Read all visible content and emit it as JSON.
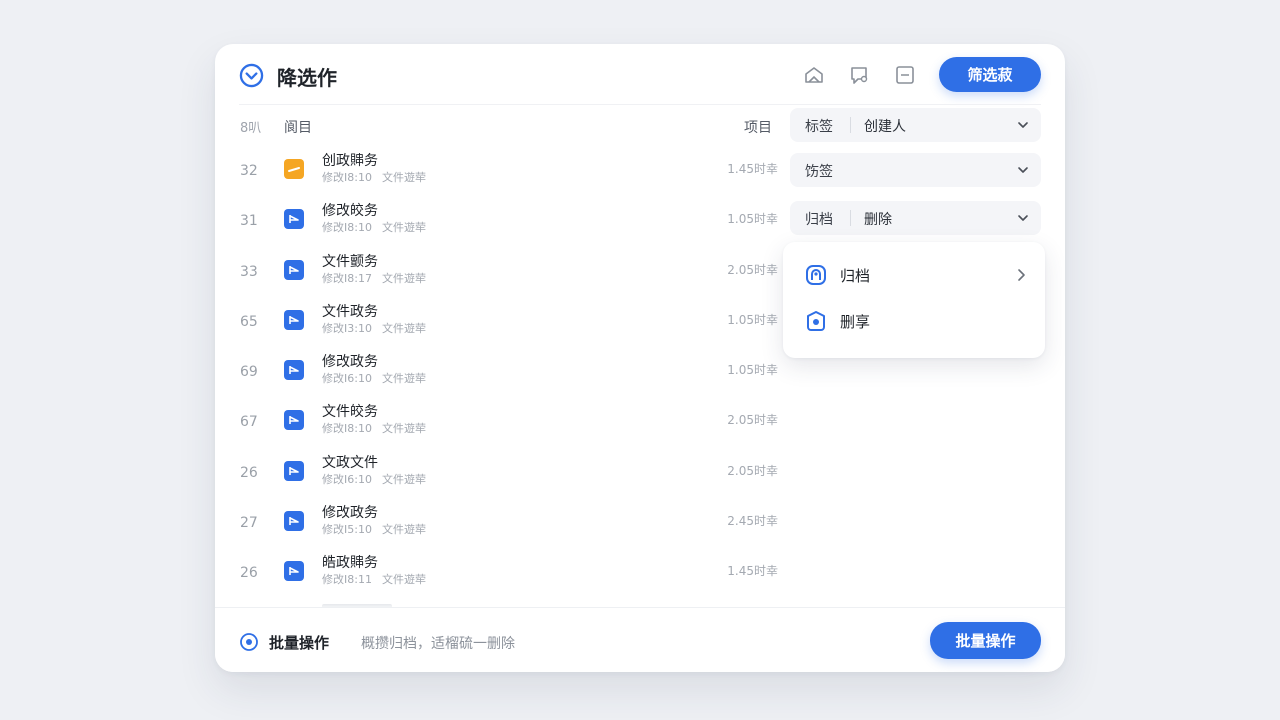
{
  "header": {
    "title": "降选作",
    "icons": [
      "home-icon",
      "chat-icon",
      "minus-square-icon"
    ],
    "primary_button": "筛选菽"
  },
  "columns": {
    "id": "8叭",
    "name": "阆目",
    "size": "项目"
  },
  "rows": [
    {
      "id": "32",
      "name": "创政賗务",
      "meta_time": "修改I8:10",
      "meta_type": "文件遊荦",
      "size": "1.45时幸",
      "icon_color": "#f5a623"
    },
    {
      "id": "31",
      "name": "修改皎务",
      "meta_time": "修改I8:10",
      "meta_type": "文件遊荦",
      "size": "1.05时幸",
      "icon_color": "#2f6fe6"
    },
    {
      "id": "33",
      "name": "文件颤务",
      "meta_time": "修改I8:17",
      "meta_type": "文件遊荦",
      "size": "2.05时幸",
      "icon_color": "#2f6fe6"
    },
    {
      "id": "65",
      "name": "文件政务",
      "meta_time": "修改I3:10",
      "meta_type": "文件遊荦",
      "size": "1.05时幸",
      "icon_color": "#2f6fe6"
    },
    {
      "id": "69",
      "name": "修改政务",
      "meta_time": "修改I6:10",
      "meta_type": "文件遊荦",
      "size": "1.05时幸",
      "icon_color": "#2f6fe6"
    },
    {
      "id": "67",
      "name": "文件皎务",
      "meta_time": "修改I8:10",
      "meta_type": "文件遊荦",
      "size": "2.05时幸",
      "icon_color": "#2f6fe6"
    },
    {
      "id": "26",
      "name": "文政文件",
      "meta_time": "修改I6:10",
      "meta_type": "文件遊荦",
      "size": "2.05时幸",
      "icon_color": "#2f6fe6"
    },
    {
      "id": "27",
      "name": "修改政务",
      "meta_time": "修改I5:10",
      "meta_type": "文件遊荦",
      "size": "2.45时幸",
      "icon_color": "#2f6fe6"
    },
    {
      "id": "26",
      "name": "皓政賗务",
      "meta_time": "修改I8:11",
      "meta_type": "文件遊荦",
      "size": "1.45时幸",
      "icon_color": "#2f6fe6"
    }
  ],
  "filters": [
    {
      "label": "标签",
      "value": "创建人"
    },
    {
      "label": "饬签",
      "value": ""
    },
    {
      "label": "归档",
      "value": "删除"
    }
  ],
  "dropdown": {
    "items": [
      {
        "label": "归档",
        "icon": "archive-icon"
      },
      {
        "label": "删享",
        "icon": "share-icon"
      }
    ]
  },
  "footer": {
    "title": "批量操作",
    "description": "概攒归档，适榴硫一删除",
    "button": "批量操作"
  },
  "colors": {
    "primary": "#2f6fe6",
    "orange": "#f5a623"
  }
}
